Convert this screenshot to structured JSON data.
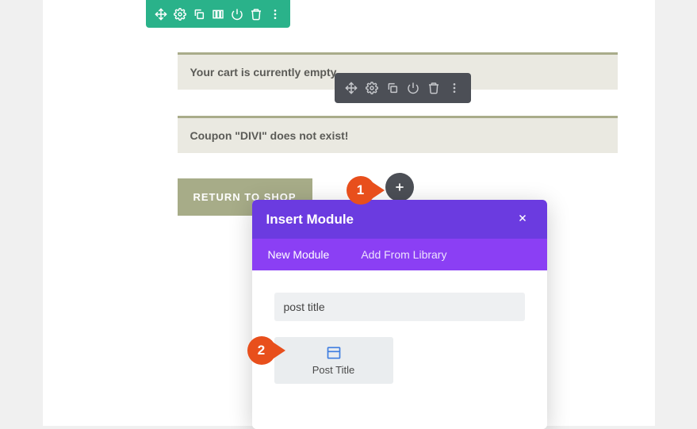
{
  "notices": {
    "cart_empty": "Your cart is currently empty.",
    "coupon_error": "Coupon \"DIVI\" does not exist!"
  },
  "buttons": {
    "return_to_shop": "RETURN TO SHOP"
  },
  "steps": {
    "step1": "1",
    "step2": "2"
  },
  "modal": {
    "title": "Insert Module",
    "tab_new": "New Module",
    "tab_library": "Add From Library",
    "search_value": "post title",
    "module_label": "Post Title"
  },
  "icons": {
    "section_toolbar": [
      "move",
      "settings",
      "duplicate",
      "columns",
      "power",
      "trash",
      "more"
    ],
    "module_toolbar": [
      "move",
      "settings",
      "duplicate",
      "power",
      "trash",
      "more"
    ]
  }
}
